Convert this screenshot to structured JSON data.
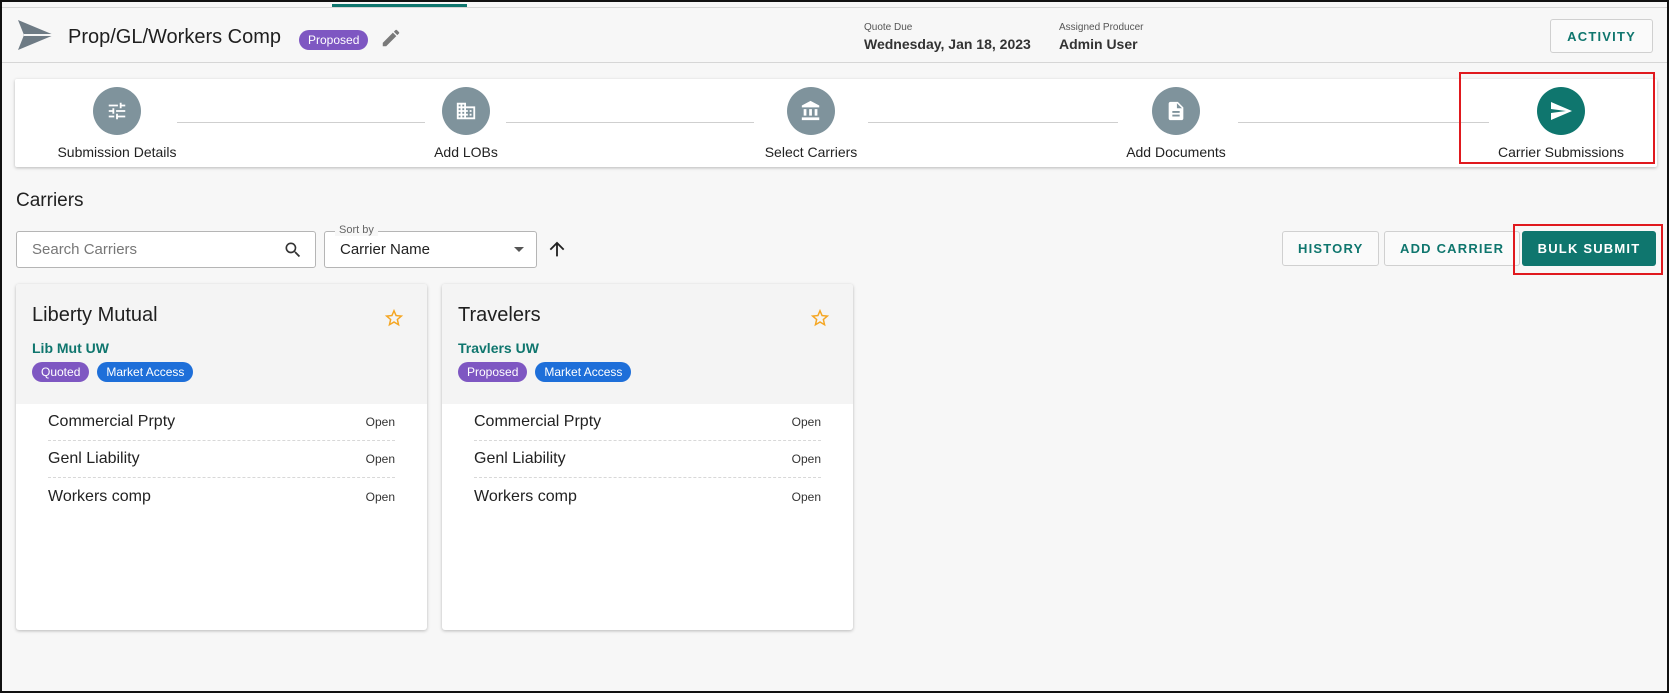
{
  "header": {
    "title": "Prop/GL/Workers Comp",
    "status_badge": "Proposed",
    "quote_due_label": "Quote Due",
    "quote_due_value": "Wednesday, Jan 18, 2023",
    "producer_label": "Assigned Producer",
    "producer_value": "Admin User",
    "activity_label": "ACTIVITY"
  },
  "stepper": {
    "steps": [
      {
        "label": "Submission Details",
        "icon": "sliders-icon"
      },
      {
        "label": "Add LOBs",
        "icon": "building-icon"
      },
      {
        "label": "Select Carriers",
        "icon": "bank-icon"
      },
      {
        "label": "Add Documents",
        "icon": "document-icon"
      },
      {
        "label": "Carrier Submissions",
        "icon": "send-icon",
        "active": true
      }
    ]
  },
  "carriers": {
    "title": "Carriers",
    "search_placeholder": "Search Carriers",
    "sort_label": "Sort by",
    "sort_value": "Carrier Name",
    "history_label": "HISTORY",
    "add_carrier_label": "ADD CARRIER",
    "bulk_submit_label": "BULK SUBMIT"
  },
  "cards": [
    {
      "name": "Liberty Mutual",
      "underwriter": "Lib Mut UW",
      "badges": [
        "Quoted",
        "Market Access"
      ],
      "lobs": [
        {
          "name": "Commercial Prpty",
          "status": "Open"
        },
        {
          "name": "Genl Liability",
          "status": "Open"
        },
        {
          "name": "Workers comp",
          "status": "Open"
        }
      ]
    },
    {
      "name": "Travelers",
      "underwriter": "Travlers UW",
      "badges": [
        "Proposed",
        "Market Access"
      ],
      "lobs": [
        {
          "name": "Commercial Prpty",
          "status": "Open"
        },
        {
          "name": "Genl Liability",
          "status": "Open"
        },
        {
          "name": "Workers comp",
          "status": "Open"
        }
      ]
    }
  ],
  "colors": {
    "brand": "#0f766e",
    "step_inactive": "#7f939c",
    "badge_purple": "#7e57c2",
    "badge_blue": "#1e6fd9",
    "highlight": "#e0191e",
    "star": "#f5a623"
  }
}
